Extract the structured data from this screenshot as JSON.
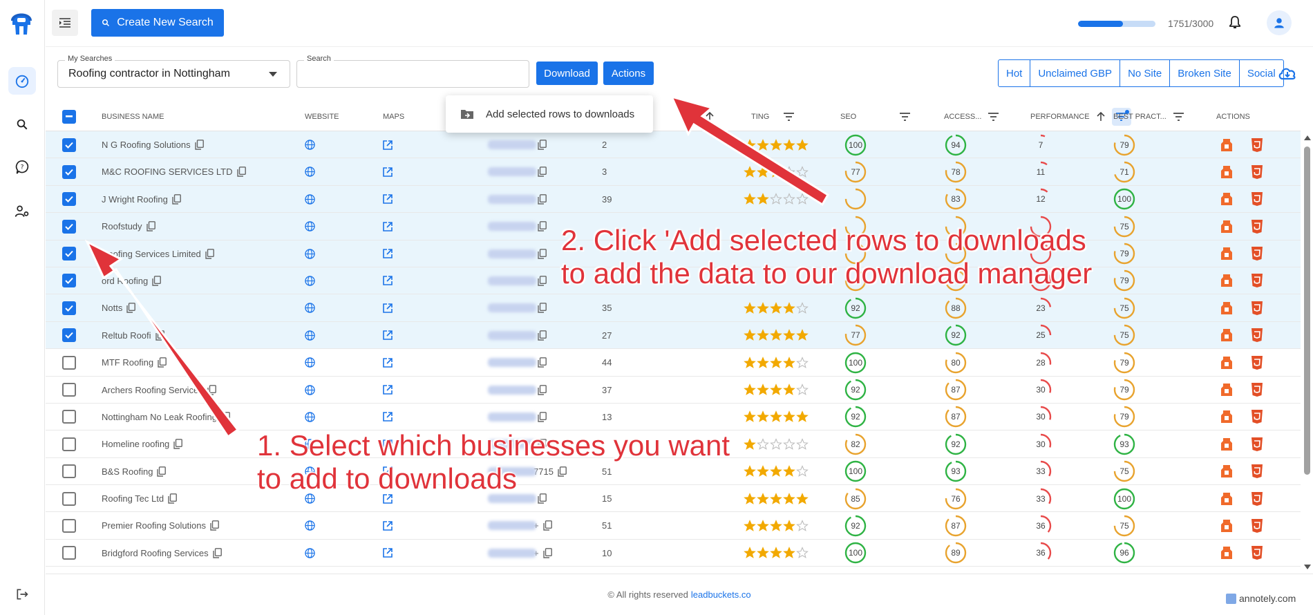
{
  "sidebar": {
    "items": [
      {
        "icon": "dashboard-icon"
      },
      {
        "icon": "search-icon"
      },
      {
        "icon": "help-icon"
      },
      {
        "icon": "user-settings-icon"
      }
    ],
    "logout_icon": "logout-icon"
  },
  "topbar": {
    "create_label": "Create New Search",
    "credits_used": 1751,
    "credits_total": 3000,
    "credits_text": "1751/3000"
  },
  "toolbar": {
    "my_searches_label": "My Searches",
    "my_searches_value": "Roofing contractor in Nottingham",
    "search_label": "Search",
    "search_value": "",
    "download_label": "Download",
    "actions_label": "Actions",
    "filters": [
      "Hot",
      "Unclaimed GBP",
      "No Site",
      "Broken Site",
      "Social"
    ]
  },
  "actions_menu": {
    "item": "Add selected rows to downloads"
  },
  "table": {
    "headers": {
      "name": "BUSINESS NAME",
      "website": "WEBSITE",
      "maps": "MAPS",
      "rating": "TING",
      "seo": "SEO",
      "access": "ACCESS...",
      "performance": "PERFORMANCE",
      "best": "BEST PRACT...",
      "actions": "ACTIONS"
    },
    "rows": [
      {
        "name": "N G Roofing Solutions",
        "phone": "",
        "reviews": "2",
        "stars": 5,
        "seo": 100,
        "access": 94,
        "perf": 7,
        "best": 79,
        "selected": true
      },
      {
        "name": "M&C ROOFING SERVICES LTD",
        "phone": "",
        "reviews": "3",
        "stars": 3,
        "seo": 77,
        "access": 78,
        "perf": 11,
        "best": 71,
        "selected": true
      },
      {
        "name": "J Wright Roofing",
        "phone": "",
        "reviews": "39",
        "stars": 2,
        "seo": "",
        "access": 83,
        "perf": 12,
        "best": 100,
        "selected": true
      },
      {
        "name": "Roofstudy",
        "phone": "",
        "reviews": "",
        "stars": 0,
        "seo": "",
        "access": "",
        "perf": "",
        "best": 75,
        "selected": true
      },
      {
        "name": "Roofing Services Limited",
        "phone": "",
        "reviews": "",
        "stars": 0,
        "seo": "",
        "access": "",
        "perf": "",
        "best": 79,
        "selected": true
      },
      {
        "name": "ord Roofing",
        "phone": "",
        "reviews": "",
        "stars": 0,
        "seo": "",
        "access": "",
        "perf": "",
        "best": 79,
        "selected": true
      },
      {
        "name": "Notts",
        "phone": "",
        "reviews": "35",
        "stars": 4,
        "seo": 92,
        "access": 88,
        "perf": 23,
        "best": 75,
        "selected": true
      },
      {
        "name": "Reltub Roofi",
        "phone": "",
        "reviews": "27",
        "stars": 5,
        "seo": 77,
        "access": 92,
        "perf": 25,
        "best": 75,
        "selected": true
      },
      {
        "name": "MTF Roofing",
        "phone": "",
        "reviews": "44",
        "stars": 4,
        "seo": 100,
        "access": 80,
        "perf": 28,
        "best": 79,
        "selected": false
      },
      {
        "name": "Archers Roofing Services",
        "phone": "",
        "reviews": "37",
        "stars": 4,
        "seo": 92,
        "access": 87,
        "perf": 30,
        "best": 79,
        "selected": false
      },
      {
        "name": "Nottingham No Leak Roofing",
        "phone": "",
        "reviews": "13",
        "stars": 5,
        "seo": 92,
        "access": 87,
        "perf": 30,
        "best": 79,
        "selected": false
      },
      {
        "name": "Homeline roofing",
        "phone": "",
        "reviews": "",
        "stars": 1,
        "seo": 82,
        "access": 92,
        "perf": 30,
        "best": 93,
        "selected": false
      },
      {
        "name": "B&S Roofing",
        "phone": "7715",
        "reviews": "51",
        "stars": 4,
        "seo": 100,
        "access": 93,
        "perf": 33,
        "best": 75,
        "selected": false
      },
      {
        "name": "Roofing Tec Ltd",
        "phone": "",
        "reviews": "15",
        "stars": 5,
        "seo": 85,
        "access": 76,
        "perf": 33,
        "best": 100,
        "selected": false
      },
      {
        "name": "Premier Roofing Solutions",
        "phone": "+",
        "reviews": "51",
        "stars": 4,
        "seo": 92,
        "access": 87,
        "perf": 36,
        "best": 75,
        "selected": false
      },
      {
        "name": "Bridgford Roofing Services",
        "phone": "+",
        "reviews": "10",
        "stars": 4,
        "seo": 100,
        "access": 89,
        "perf": 36,
        "best": 96,
        "selected": false
      }
    ]
  },
  "footer": {
    "text": "© All rights reserved",
    "link": "leadbuckets.co"
  },
  "watermark": "annotely.com",
  "annotations": {
    "step1_line1": "1. Select which businesses you want",
    "step1_line2": "to add to downloads",
    "step2_line1": "2. Click 'Add selected rows to downloads",
    "step2_line2": "to add the data to our download manager"
  },
  "colors": {
    "accent": "#1a73e8",
    "good": "#2fb344",
    "medium": "#e8a32e",
    "bad": "#e84a4a",
    "star": "#f2a900",
    "annotation": "#e0333a"
  }
}
